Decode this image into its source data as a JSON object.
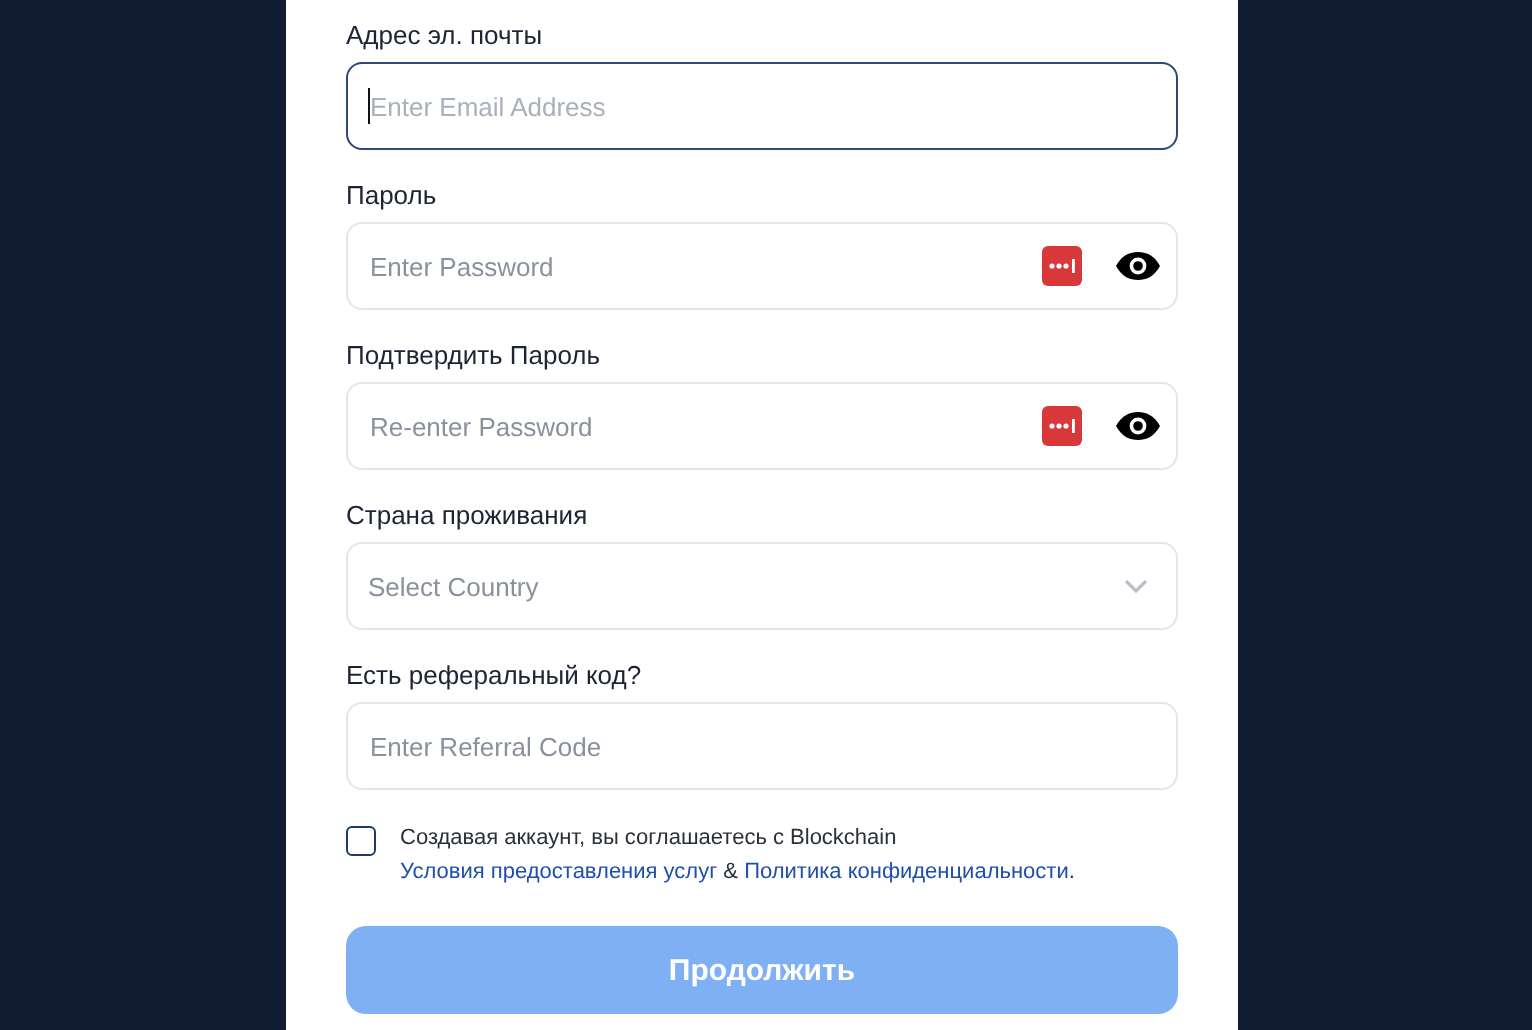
{
  "fields": [
    {
      "kind": "text",
      "label": "Адрес эл. почты",
      "placeholder": "Enter Email Address",
      "focused": true
    },
    {
      "kind": "password",
      "label": "Пароль",
      "placeholder": "Enter Password",
      "focused": false
    },
    {
      "kind": "password",
      "label": "Подтвердить Пароль",
      "placeholder": "Re-enter Password",
      "focused": false
    },
    {
      "kind": "select",
      "label": "Страна проживания",
      "placeholder": "Select Country",
      "focused": false
    },
    {
      "kind": "text",
      "label": "Есть реферальный код?",
      "placeholder": "Enter Referral Code",
      "focused": false
    }
  ],
  "agreement": {
    "checked": false,
    "text": "Создавая аккаунт, вы соглашаетесь с Blockchain",
    "terms_link": "Условия предоставления услуг",
    "separator": "&",
    "privacy_link": "Политика конфиденциальности",
    "end": "."
  },
  "submit": {
    "label": "Продолжить",
    "disabled": true
  }
}
